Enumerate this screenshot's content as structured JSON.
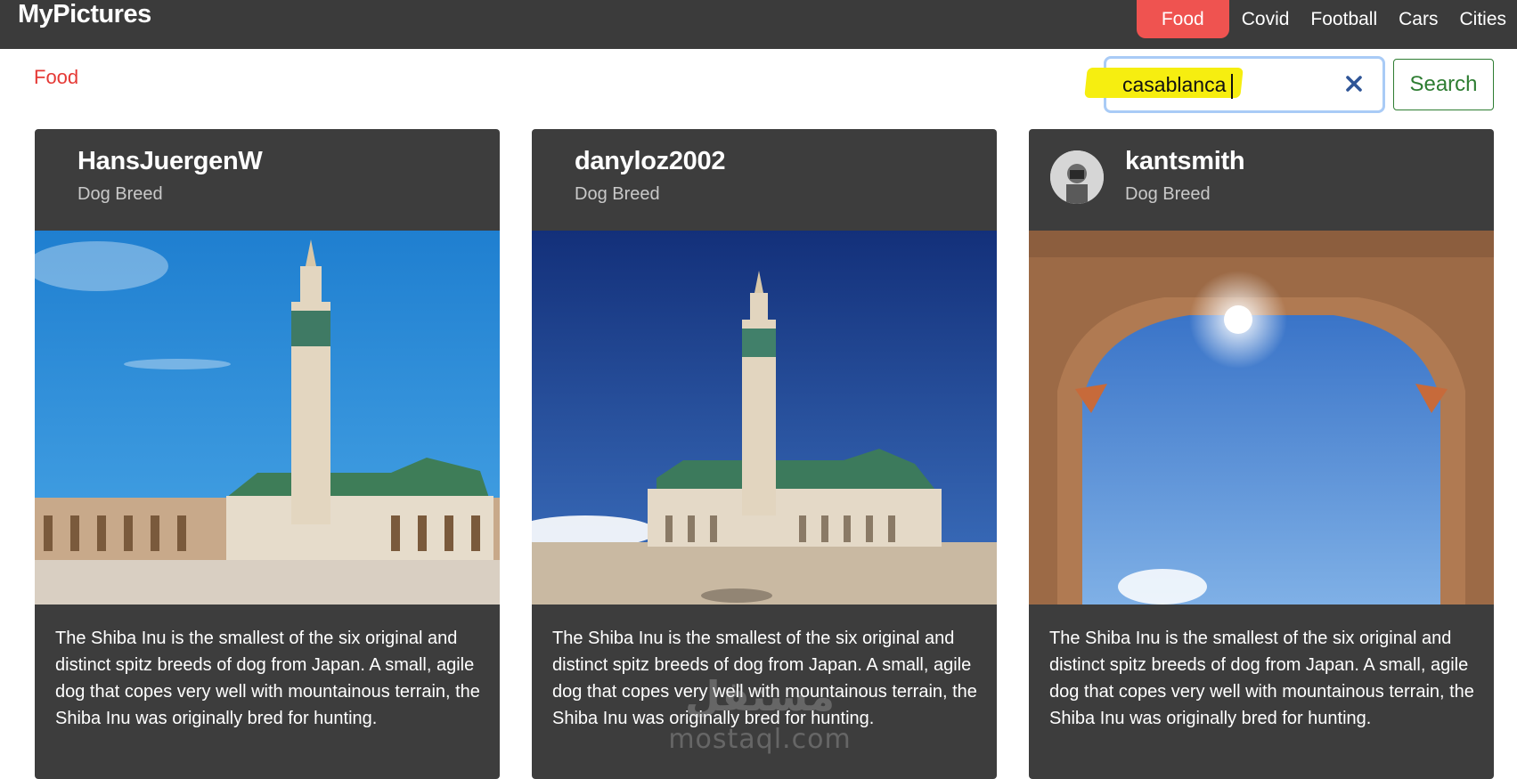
{
  "app": {
    "brand": "MyPictures"
  },
  "nav": {
    "items": [
      {
        "label": "Food",
        "active": true
      },
      {
        "label": "Covid",
        "active": false
      },
      {
        "label": "Football",
        "active": false
      },
      {
        "label": "Cars",
        "active": false
      },
      {
        "label": "Cities",
        "active": false
      }
    ]
  },
  "breadcrumb": "Food",
  "search": {
    "value": "casablanca",
    "button_label": "Search",
    "clear_icon": "close-icon"
  },
  "cards": [
    {
      "user": "HansJuergenW",
      "subtitle": "Dog Breed",
      "has_avatar": false,
      "image": "hassan-ii-mosque-photo",
      "text": "The Shiba Inu is the smallest of the six original and distinct spitz breeds of dog from Japan. A small, agile dog that copes very well with mountainous terrain, the Shiba Inu was originally bred for hunting."
    },
    {
      "user": "danyloz2002",
      "subtitle": "Dog Breed",
      "has_avatar": false,
      "image": "hassan-ii-mosque-plaza-photo",
      "text": "The Shiba Inu is the smallest of the six original and distinct spitz breeds of dog from Japan. A small, agile dog that copes very well with mountainous terrain, the Shiba Inu was originally bred for hunting."
    },
    {
      "user": "kantsmith",
      "subtitle": "Dog Breed",
      "has_avatar": true,
      "image": "moorish-arch-sky-photo",
      "text": "The Shiba Inu is the smallest of the six original and distinct spitz breeds of dog from Japan. A small, agile dog that copes very well with mountainous terrain, the Shiba Inu was originally bred for hunting."
    }
  ],
  "watermark": {
    "arabic": "مستقل",
    "latin": "mostaql.com"
  },
  "colors": {
    "navbar": "#3b3b3b",
    "active_nav": "#ef5350",
    "breadcrumb": "#e53935",
    "search_button": "#2e7d32",
    "card": "#3d3d3d",
    "highlight": "#f6ee10"
  }
}
